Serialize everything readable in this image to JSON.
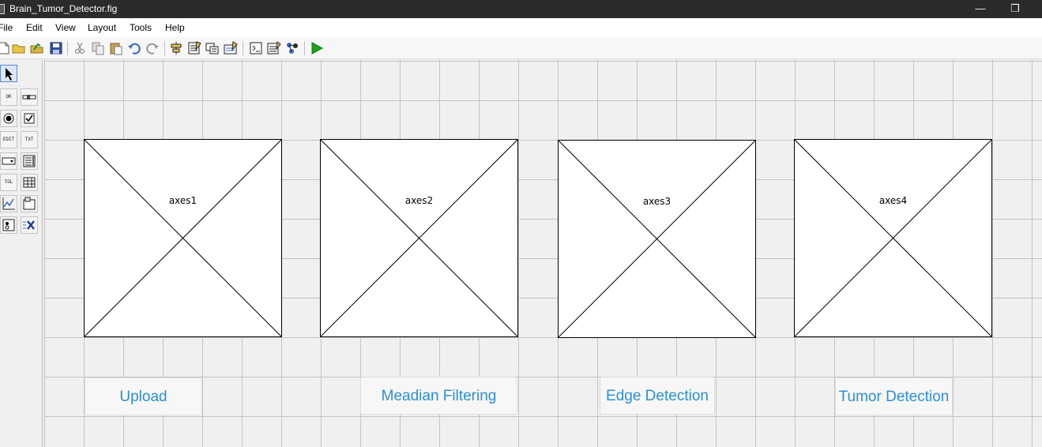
{
  "window": {
    "title": "Brain_Tumor_Detector.fig",
    "minimize_glyph": "—",
    "restore_glyph": "❐"
  },
  "menu": [
    "File",
    "Edit",
    "View",
    "Layout",
    "Tools",
    "Help"
  ],
  "toolbar": {
    "icons": [
      "new-file-icon",
      "open-file-icon",
      "open-folder-icon",
      "save-icon",
      "cut-icon",
      "copy-icon",
      "paste-icon",
      "undo-icon",
      "redo-icon",
      "align-objects-icon",
      "menu-editor-icon",
      "tab-order-editor-icon",
      "toolbar-editor-icon",
      "editor-icon",
      "property-inspector-icon",
      "object-browser-icon",
      "run-figure-icon"
    ]
  },
  "palette": {
    "items": [
      "select-tool",
      "pushbutton-tool",
      "slider-tool",
      "radio-button-tool",
      "checkbox-tool",
      "edit-text-tool",
      "static-text-tool",
      "popup-menu-tool",
      "listbox-tool",
      "toggle-button-tool",
      "table-tool",
      "axes-tool",
      "panel-tool",
      "button-group-tool",
      "activex-tool"
    ],
    "texts": {
      "pushbutton": "OK",
      "edit": "EDIT",
      "text": "TXT",
      "toggle": "TGL"
    }
  },
  "axes": [
    {
      "label": "axes1"
    },
    {
      "label": "axes2"
    },
    {
      "label": "axes3"
    },
    {
      "label": "axes4"
    }
  ],
  "buttons": [
    {
      "label": "Upload"
    },
    {
      "label": "Meadian Filtering"
    },
    {
      "label": "Edge Detection"
    },
    {
      "label": "Tumor Detection"
    }
  ],
  "colors": {
    "button_text": "#2a8fd6",
    "title_bar": "#2b2b2b",
    "run_icon": "#1ea01e"
  }
}
